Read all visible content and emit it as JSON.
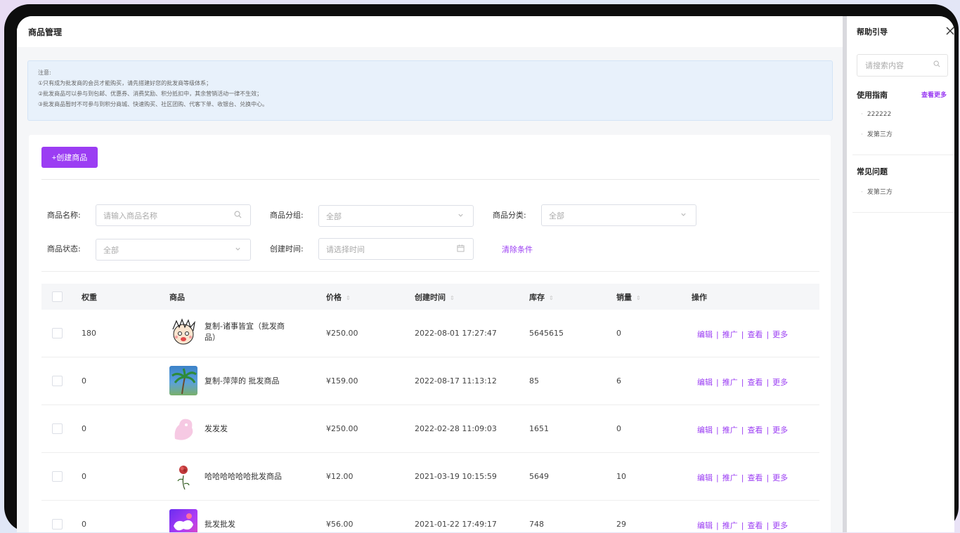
{
  "page": {
    "title": "商品管理"
  },
  "notice": {
    "lines": [
      "注意:",
      "①只有成为批发商的会员才能购买，请先搭建好您的批发商等级体系；",
      "②批发商品可以参与到包邮、优惠券、消费奖励、积分抵扣中，其余营销活动一律不生效；",
      "③批发商品暂时不可参与到积分商城、快速购买、社区团购、代客下单、收银台、兑换中心。"
    ]
  },
  "toolbar": {
    "create_label": "+创建商品"
  },
  "filters": {
    "name_label": "商品名称:",
    "name_placeholder": "请输入商品名称",
    "group_label": "商品分组:",
    "group_value": "全部",
    "category_label": "商品分类:",
    "category_value": "全部",
    "status_label": "商品状态:",
    "status_value": "全部",
    "time_label": "创建时间:",
    "time_placeholder": "请选择时间",
    "clear_label": "清除条件"
  },
  "table": {
    "headers": {
      "weight": "权重",
      "product": "商品",
      "price": "价格",
      "created": "创建时间",
      "stock": "库存",
      "sales": "销量",
      "actions": "操作"
    },
    "actions": [
      "编辑",
      "推广",
      "查看",
      "更多"
    ],
    "rows": [
      {
        "weight": "180",
        "name": "复制-诸事皆宜（批发商品）",
        "price": "¥250.00",
        "created": "2022-08-01 17:27:47",
        "stock": "5645615",
        "sales": "0",
        "thumb": "cartoon-face"
      },
      {
        "weight": "0",
        "name": "复制-萍萍的 批发商品",
        "price": "¥159.00",
        "created": "2022-08-17 11:13:12",
        "stock": "85",
        "sales": "6",
        "thumb": "palm-tree"
      },
      {
        "weight": "0",
        "name": "发发发",
        "price": "¥250.00",
        "created": "2022-02-28 11:09:03",
        "stock": "1651",
        "sales": "0",
        "thumb": "pink-figure"
      },
      {
        "weight": "0",
        "name": "哈哈哈哈哈哈批发商品",
        "price": "¥12.00",
        "created": "2021-03-19 10:15:59",
        "stock": "5649",
        "sales": "10",
        "thumb": "rose"
      },
      {
        "weight": "0",
        "name": "批发批发",
        "price": "¥56.00",
        "created": "2021-01-22 17:49:17",
        "stock": "748",
        "sales": "29",
        "thumb": "purple-abstract"
      }
    ]
  },
  "help": {
    "title": "帮助引导",
    "search_placeholder": "请搜索内容",
    "guide_title": "使用指南",
    "guide_more": "查看更多",
    "guide_items": [
      "222222",
      "发第三方"
    ],
    "faq_title": "常见问题",
    "faq_items": [
      "发第三方"
    ]
  },
  "colors": {
    "accent": "#9b3df3",
    "notice_bg": "#e8f1fb"
  }
}
